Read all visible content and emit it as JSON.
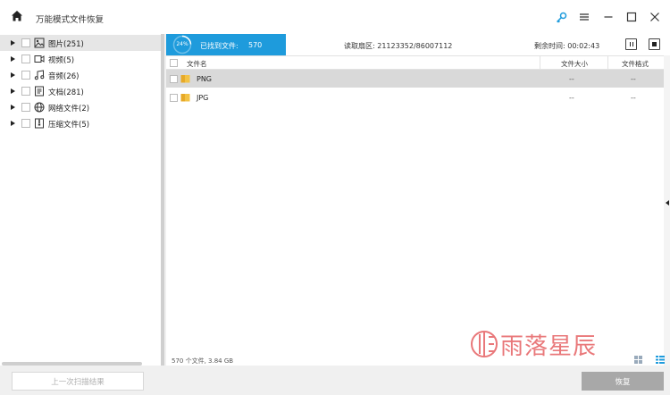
{
  "titlebar": {
    "title": "万能模式文件恢复"
  },
  "sidebar": {
    "items": [
      {
        "label": "图片(251)",
        "icon": "image-icon"
      },
      {
        "label": "视频(5)",
        "icon": "video-icon"
      },
      {
        "label": "音频(26)",
        "icon": "music-icon"
      },
      {
        "label": "文档(281)",
        "icon": "document-icon"
      },
      {
        "label": "网络文件(2)",
        "icon": "globe-icon"
      },
      {
        "label": "压缩文件(5)",
        "icon": "archive-icon"
      }
    ],
    "selected_index": 0
  },
  "scan": {
    "progress_label": "24%",
    "progress": 0.24,
    "found_label": "已找到文件:",
    "found_count": "570",
    "sector_text": "读取扇区:  21123352/86007112",
    "remaining_text": "剩余时间:  00:02:43"
  },
  "table": {
    "columns": [
      "文件名",
      "文件大小",
      "文件格式"
    ],
    "rows": [
      {
        "name": "PNG",
        "size": "--",
        "format": "--"
      },
      {
        "name": "JPG",
        "size": "--",
        "format": "--"
      }
    ]
  },
  "status": {
    "summary": "570 个文件, 3.84 GB"
  },
  "watermark": {
    "text": "雨落星辰"
  },
  "footer": {
    "prev_label": "上一次扫描结果",
    "recover_label": "恢复"
  },
  "colors": {
    "accent": "#1e9bdc",
    "watermark": "#e9787a",
    "recover_disabled": "#a8a8a8"
  }
}
